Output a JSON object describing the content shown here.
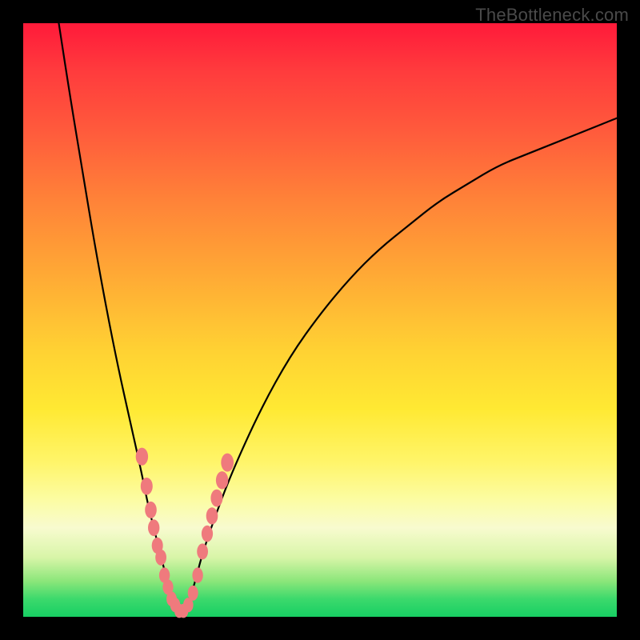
{
  "watermark": "TheBottleneck.com",
  "colors": {
    "frame": "#000000",
    "curve": "#000000",
    "marker": "#ef7a7d",
    "gradient_top": "#ff1a3a",
    "gradient_bottom": "#17cf63"
  },
  "chart_data": {
    "type": "line",
    "title": "",
    "xlabel": "",
    "ylabel": "",
    "xlim": [
      0,
      100
    ],
    "ylim": [
      0,
      100
    ],
    "grid": false,
    "legend": false,
    "background": "vertical-gradient red→yellow→green",
    "series": [
      {
        "name": "left-curve",
        "x": [
          6,
          8,
          10,
          12,
          14,
          16,
          18,
          20,
          21,
          22,
          23,
          24,
          25,
          26
        ],
        "y": [
          100,
          87,
          75,
          63,
          52,
          42,
          33,
          24,
          19,
          15,
          11,
          7,
          4,
          1
        ]
      },
      {
        "name": "right-curve",
        "x": [
          27,
          28,
          29,
          30,
          32,
          35,
          40,
          45,
          50,
          55,
          60,
          65,
          70,
          75,
          80,
          85,
          90,
          95,
          100
        ],
        "y": [
          1,
          3,
          6,
          10,
          16,
          24,
          35,
          44,
          51,
          57,
          62,
          66,
          70,
          73,
          76,
          78,
          80,
          82,
          84
        ]
      }
    ],
    "markers": {
      "name": "highlighted-points",
      "color": "#ef7a7d",
      "points": [
        {
          "x": 20.0,
          "y": 27
        },
        {
          "x": 20.8,
          "y": 22
        },
        {
          "x": 21.5,
          "y": 18
        },
        {
          "x": 22.0,
          "y": 15
        },
        {
          "x": 22.6,
          "y": 12
        },
        {
          "x": 23.2,
          "y": 10
        },
        {
          "x": 23.8,
          "y": 7
        },
        {
          "x": 24.4,
          "y": 5
        },
        {
          "x": 25.0,
          "y": 3
        },
        {
          "x": 25.6,
          "y": 2
        },
        {
          "x": 26.3,
          "y": 1
        },
        {
          "x": 27.0,
          "y": 1
        },
        {
          "x": 27.8,
          "y": 2
        },
        {
          "x": 28.6,
          "y": 4
        },
        {
          "x": 29.4,
          "y": 7
        },
        {
          "x": 30.2,
          "y": 11
        },
        {
          "x": 31.0,
          "y": 14
        },
        {
          "x": 31.8,
          "y": 17
        },
        {
          "x": 32.6,
          "y": 20
        },
        {
          "x": 33.5,
          "y": 23
        },
        {
          "x": 34.4,
          "y": 26
        }
      ]
    }
  }
}
